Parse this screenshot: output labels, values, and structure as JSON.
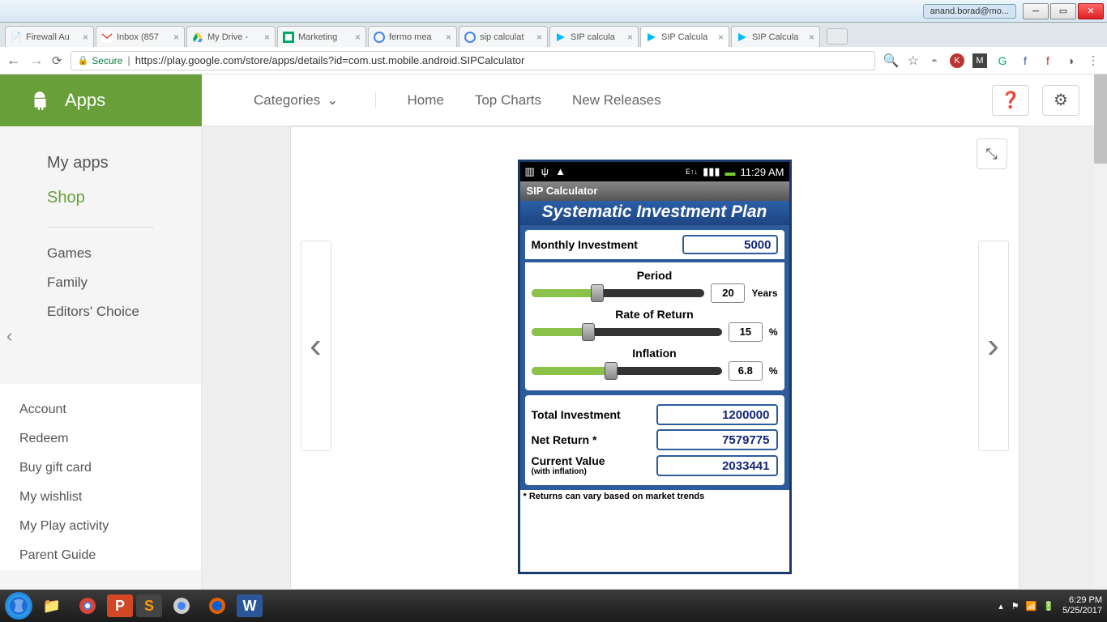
{
  "window": {
    "user": "anand.borad@mo..."
  },
  "tabs": [
    {
      "title": "Firewall Au",
      "icon": "page"
    },
    {
      "title": "Inbox (857",
      "icon": "gmail"
    },
    {
      "title": "My Drive -",
      "icon": "drive"
    },
    {
      "title": "Marketing",
      "icon": "sheets"
    },
    {
      "title": "fermo mea",
      "icon": "google"
    },
    {
      "title": "sip calculat",
      "icon": "google"
    },
    {
      "title": "SIP calcula",
      "icon": "play"
    },
    {
      "title": "SIP Calcula",
      "icon": "play"
    },
    {
      "title": "SIP Calcula",
      "icon": "play"
    }
  ],
  "active_tab": 7,
  "url": {
    "secure": "Secure",
    "full": "https://play.google.com/store/apps/details?id=com.ust.mobile.android.SIPCalculator"
  },
  "play": {
    "apps": "Apps",
    "nav": {
      "categories": "Categories",
      "home": "Home",
      "top": "Top Charts",
      "new": "New Releases"
    },
    "side_top": [
      "My apps",
      "Shop"
    ],
    "side_mid": [
      "Games",
      "Family",
      "Editors' Choice"
    ],
    "side_bottom": [
      "Account",
      "Redeem",
      "Buy gift card",
      "My wishlist",
      "My Play activity",
      "Parent Guide"
    ]
  },
  "app": {
    "status_time": "11:29 AM",
    "bar_title": "SIP Calculator",
    "title": "Systematic Investment Plan",
    "monthly_label": "Monthly Investment",
    "monthly_value": "5000",
    "period_label": "Period",
    "period_value": "20",
    "period_unit": "Years",
    "period_fill": 38,
    "ror_label": "Rate of Return",
    "ror_value": "15",
    "ror_unit": "%",
    "ror_fill": 30,
    "inf_label": "Inflation",
    "inf_value": "6.8",
    "inf_unit": "%",
    "inf_fill": 42,
    "total_label": "Total Investment",
    "total_value": "1200000",
    "net_label": "Net Return *",
    "net_value": "7579775",
    "cur_label": "Current Value",
    "cur_sub": "(with inflation)",
    "cur_value": "2033441",
    "footnote": "* Returns can vary based on market trends"
  },
  "taskbar": {
    "time": "6:29 PM",
    "date": "5/25/2017"
  }
}
